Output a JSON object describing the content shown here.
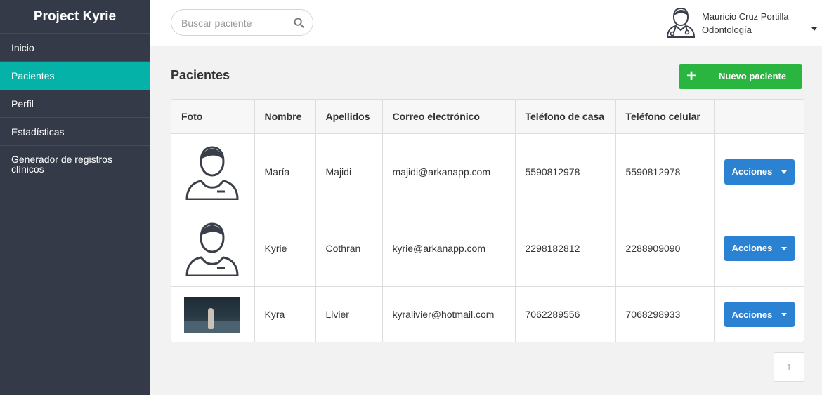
{
  "app": {
    "title": "Project Kyrie"
  },
  "sidebar": {
    "items": [
      {
        "label": "Inicio"
      },
      {
        "label": "Pacientes"
      },
      {
        "label": "Perfil"
      },
      {
        "label": "Estadísticas"
      },
      {
        "label": "Generador de registros clínicos"
      }
    ],
    "active": "Pacientes"
  },
  "search": {
    "placeholder": "Buscar paciente",
    "value": ""
  },
  "user": {
    "name": "Mauricio Cruz Portilla",
    "role": "Odontología"
  },
  "page": {
    "title": "Pacientes",
    "new_button_label": "Nuevo paciente"
  },
  "table": {
    "headers": [
      "Foto",
      "Nombre",
      "Apellidos",
      "Correo electrónico",
      "Teléfono de casa",
      "Teléfono celular",
      ""
    ],
    "rows": [
      {
        "nombre": "María",
        "apellidos": "Majidi",
        "correo": "majidi@arkanapp.com",
        "tel_casa": "5590812978",
        "tel_celular": "5590812978",
        "accion": "Acciones"
      },
      {
        "nombre": "Kyrie",
        "apellidos": "Cothran",
        "correo": "kyrie@arkanapp.com",
        "tel_casa": "2298182812",
        "tel_celular": "2288909090",
        "accion": "Acciones"
      },
      {
        "nombre": "Kyra",
        "apellidos": "Livier",
        "correo": "kyralivier@hotmail.com",
        "tel_casa": "7062289556",
        "tel_celular": "7068298933",
        "accion": "Acciones"
      }
    ]
  },
  "pagination": {
    "current": "1"
  },
  "colors": {
    "sidebar": "#353a48",
    "active": "#05b2a8",
    "primary": "#2b82d3",
    "success": "#2ab541"
  }
}
